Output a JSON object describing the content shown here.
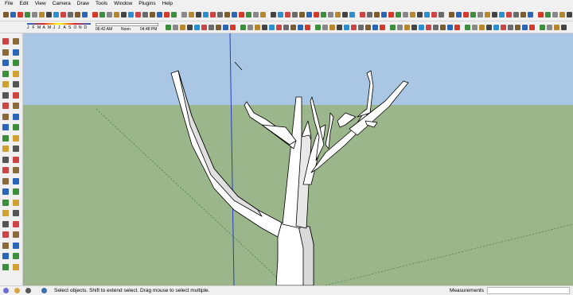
{
  "menu": [
    "File",
    "Edit",
    "View",
    "Camera",
    "Draw",
    "Tools",
    "Window",
    "Plugins",
    "Help"
  ],
  "shadow_settings": {
    "months": [
      "J",
      "F",
      "M",
      "A",
      "M",
      "J",
      "J",
      "A",
      "S",
      "O",
      "N",
      "D"
    ],
    "time_start": "06:42 AM",
    "time_noon": "Noon",
    "time_end": "04:48 PM"
  },
  "status": {
    "hint": "Select objects. Shift to extend select. Drag mouse to select multiple.",
    "measurements_label": "Measurements",
    "measurements_value": ""
  },
  "colors": {
    "sky": "#a9c7e4",
    "ground": "#9ab68a",
    "tree_fill": "#ffffff",
    "tree_shade": "#d9d9d9",
    "edge": "#000000",
    "blue_axis": "#2a3ccc"
  }
}
